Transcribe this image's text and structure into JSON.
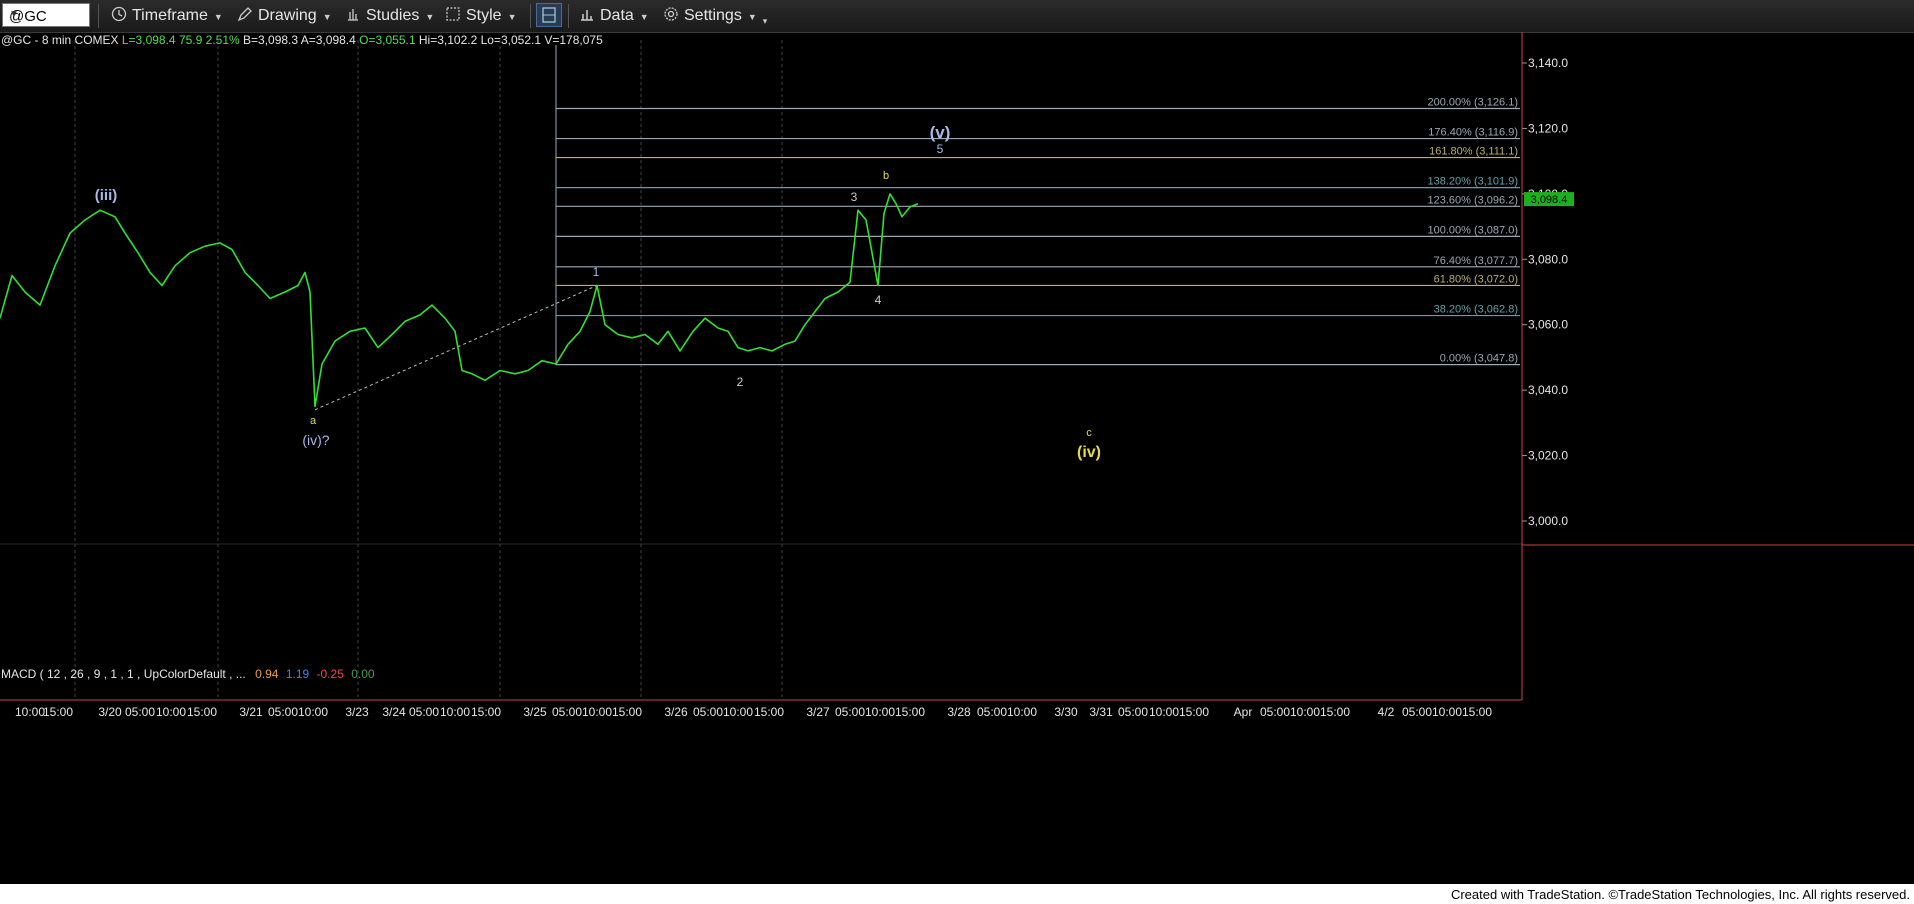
{
  "toolbar": {
    "symbol": "@GC",
    "items": [
      {
        "label": "Timeframe",
        "icon": "clock-icon"
      },
      {
        "label": "Drawing",
        "icon": "pencil-icon"
      },
      {
        "label": "Studies",
        "icon": "studies-icon"
      },
      {
        "label": "Style",
        "icon": "style-icon"
      },
      {
        "label": "Data",
        "icon": "bar-chart-icon"
      },
      {
        "label": "Settings",
        "icon": "gear-icon"
      }
    ]
  },
  "info_line": {
    "symbol": "@GC - 8 min  COMEX",
    "last": "L=3,098.4",
    "change": "75.9",
    "pct": "2.51%",
    "bid": "B=3,098.3",
    "ask": "A=3,098.4",
    "open": "O=3,055.1",
    "high": "Hi=3,102.2",
    "low": "Lo=3,052.1",
    "volume": "V=178,075"
  },
  "macd_line": {
    "label": "MACD ( 12 , 26 , 9 , 1 , 1 , UpColorDefault , ...",
    "v1": "0.94",
    "v2": "1.19",
    "v3": "-0.25",
    "v4": "0.00"
  },
  "price_axis": {
    "ticks": [
      "3,140.0",
      "3,120.0",
      "3,100.0",
      "3,080.0",
      "3,060.0",
      "3,040.0",
      "3,020.0",
      "3,000.0"
    ],
    "current_price": "3,098.4"
  },
  "time_axis": {
    "labels": [
      "10:00",
      "15:00",
      "3/20",
      "05:00",
      "10:00",
      "15:00",
      "3/21",
      "05:00",
      "10:00",
      "3/23",
      "3/24",
      "05:00",
      "10:00",
      "15:00",
      "3/25",
      "05:00",
      "10:00",
      "15:00",
      "3/26",
      "05:00",
      "10:00",
      "15:00",
      "3/27",
      "05:00",
      "10:00",
      "15:00",
      "3/28",
      "05:00",
      "10:00",
      "3/30",
      "3/31",
      "05:00",
      "10:00",
      "15:00",
      "Apr",
      "05:00",
      "10:00",
      "15:00",
      "4/2",
      "05:00",
      "10:00",
      "15:00"
    ]
  },
  "fib_levels": [
    {
      "label": "200.00% (3,126.1)",
      "price": 3126.1,
      "color": "#9aa8b4"
    },
    {
      "label": "176.40% (3,116.9)",
      "price": 3116.9,
      "color": "#9aa8b4"
    },
    {
      "label": "161.80% (3,111.1)",
      "price": 3111.1,
      "color": "#b9b16a"
    },
    {
      "label": "138.20% (3,101.9)",
      "price": 3101.9,
      "color": "#5fa3a8"
    },
    {
      "label": "123.60% (3,096.2)",
      "price": 3096.2,
      "color": "#9aa8b4"
    },
    {
      "label": "100.00% (3,087.0)",
      "price": 3087.0,
      "color": "#9aa8b4"
    },
    {
      "label": "76.40% (3,077.7)",
      "price": 3077.7,
      "color": "#9aa8b4"
    },
    {
      "label": "61.80% (3,072.0)",
      "price": 3072.0,
      "color": "#b9b16a"
    },
    {
      "label": "38.20% (3,062.8)",
      "price": 3062.8,
      "color": "#5fa3a8"
    },
    {
      "label": "0.00% (3,047.8)",
      "price": 3047.8,
      "color": "#9aa8b4"
    }
  ],
  "wave_labels": [
    {
      "text": "(iii)",
      "color": "#aab8e6"
    },
    {
      "text": "a",
      "color": "#e8d84a"
    },
    {
      "text": "(iv)?",
      "color": "#aab8e6"
    },
    {
      "text": "1",
      "color": "#aab8e6"
    },
    {
      "text": "2",
      "color": "#cccccc"
    },
    {
      "text": "3",
      "color": "#cccccc"
    },
    {
      "text": "4",
      "color": "#cccccc"
    },
    {
      "text": "b",
      "color": "#e8d84a"
    },
    {
      "text": "(v)",
      "color": "#aab8e6"
    },
    {
      "text": "5",
      "color": "#aab8e6"
    },
    {
      "text": "c",
      "color": "#e8d84a"
    },
    {
      "text": "(iv)",
      "color": "#e8d84a"
    }
  ],
  "price_path": [
    [
      0,
      3062
    ],
    [
      12,
      3075
    ],
    [
      25,
      3070
    ],
    [
      40,
      3066
    ],
    [
      55,
      3078
    ],
    [
      70,
      3088
    ],
    [
      85,
      3092
    ],
    [
      100,
      3095
    ],
    [
      115,
      3093
    ],
    [
      125,
      3088
    ],
    [
      138,
      3082
    ],
    [
      150,
      3076
    ],
    [
      162,
      3072
    ],
    [
      175,
      3078
    ],
    [
      190,
      3082
    ],
    [
      205,
      3084
    ],
    [
      220,
      3085
    ],
    [
      232,
      3083
    ],
    [
      245,
      3076
    ],
    [
      258,
      3072
    ],
    [
      270,
      3068
    ],
    [
      285,
      3070
    ],
    [
      298,
      3072
    ],
    [
      305,
      3076
    ],
    [
      310,
      3070
    ],
    [
      315,
      3035
    ],
    [
      322,
      3048
    ],
    [
      335,
      3055
    ],
    [
      350,
      3058
    ],
    [
      365,
      3059
    ],
    [
      378,
      3053
    ],
    [
      392,
      3057
    ],
    [
      405,
      3061
    ],
    [
      420,
      3063
    ],
    [
      432,
      3066
    ],
    [
      445,
      3062
    ],
    [
      455,
      3058
    ],
    [
      462,
      3046
    ],
    [
      472,
      3045
    ],
    [
      485,
      3043
    ],
    [
      500,
      3046
    ],
    [
      515,
      3045
    ],
    [
      528,
      3046
    ],
    [
      542,
      3049
    ],
    [
      556,
      3048
    ],
    [
      568,
      3054
    ],
    [
      580,
      3058
    ],
    [
      590,
      3064
    ],
    [
      597,
      3072
    ],
    [
      605,
      3060
    ],
    [
      618,
      3057
    ],
    [
      632,
      3056
    ],
    [
      645,
      3057
    ],
    [
      658,
      3054
    ],
    [
      668,
      3058
    ],
    [
      680,
      3052
    ],
    [
      693,
      3058
    ],
    [
      705,
      3062
    ],
    [
      718,
      3059
    ],
    [
      728,
      3058
    ],
    [
      738,
      3053
    ],
    [
      748,
      3052
    ],
    [
      760,
      3053
    ],
    [
      772,
      3052
    ],
    [
      785,
      3054
    ],
    [
      795,
      3055
    ],
    [
      805,
      3060
    ],
    [
      815,
      3064
    ],
    [
      825,
      3068
    ],
    [
      838,
      3070
    ],
    [
      850,
      3073
    ],
    [
      858,
      3095
    ],
    [
      866,
      3092
    ],
    [
      872,
      3082
    ],
    [
      878,
      3072
    ],
    [
      884,
      3094
    ],
    [
      890,
      3100
    ],
    [
      896,
      3097
    ],
    [
      902,
      3093
    ],
    [
      910,
      3096
    ],
    [
      918,
      3097
    ]
  ]
}
